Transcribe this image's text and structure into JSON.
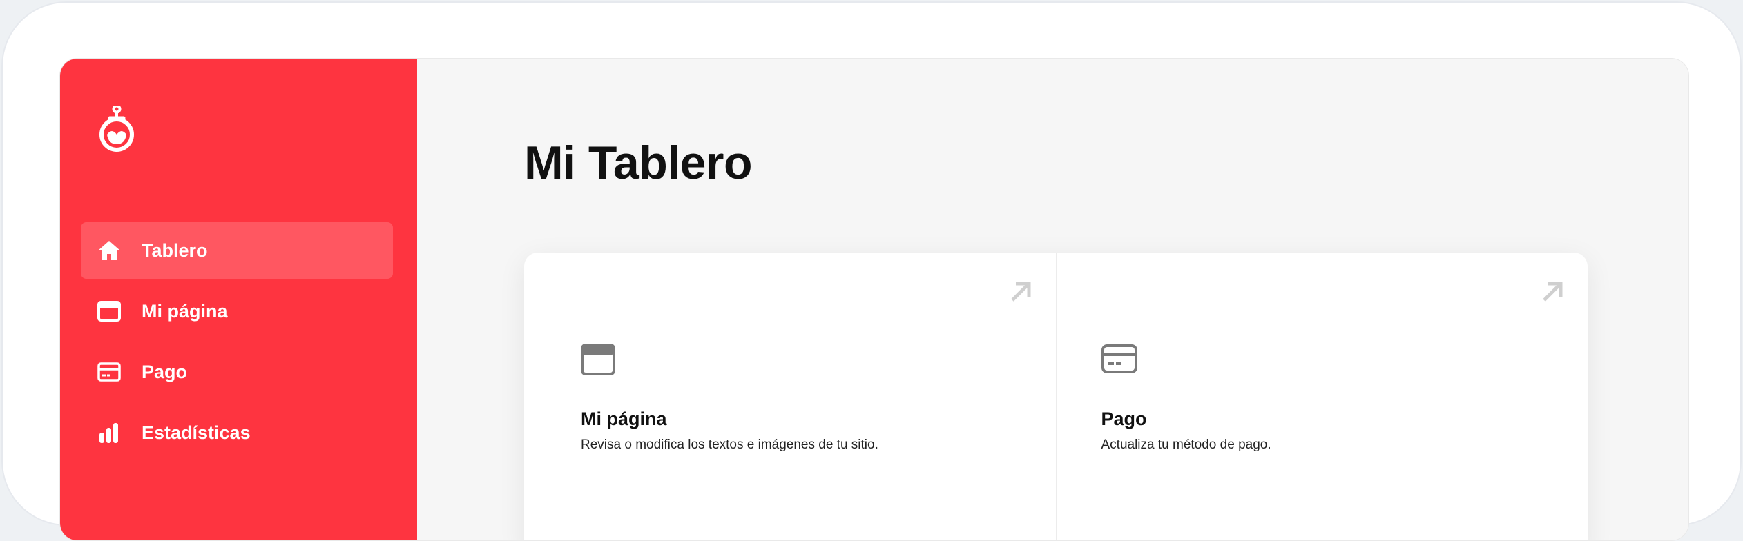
{
  "sidebar": {
    "items": [
      {
        "label": "Tablero",
        "icon": "home-icon",
        "active": true
      },
      {
        "label": "Mi página",
        "icon": "page-icon",
        "active": false
      },
      {
        "label": "Pago",
        "icon": "credit-card-icon",
        "active": false
      },
      {
        "label": "Estadísticas",
        "icon": "bar-chart-icon",
        "active": false
      }
    ]
  },
  "main": {
    "title": "Mi Tablero",
    "cards": [
      {
        "title": "Mi página",
        "description": "Revisa o modifica los textos e imágenes de tu sitio.",
        "icon": "page-icon"
      },
      {
        "title": "Pago",
        "description": "Actualiza tu método de pago.",
        "icon": "credit-card-icon"
      }
    ]
  },
  "colors": {
    "sidebar": "#fe3440",
    "active_item": "#ff5761",
    "content_bg": "#f6f6f6",
    "icon_gray": "#7a7a7a"
  }
}
